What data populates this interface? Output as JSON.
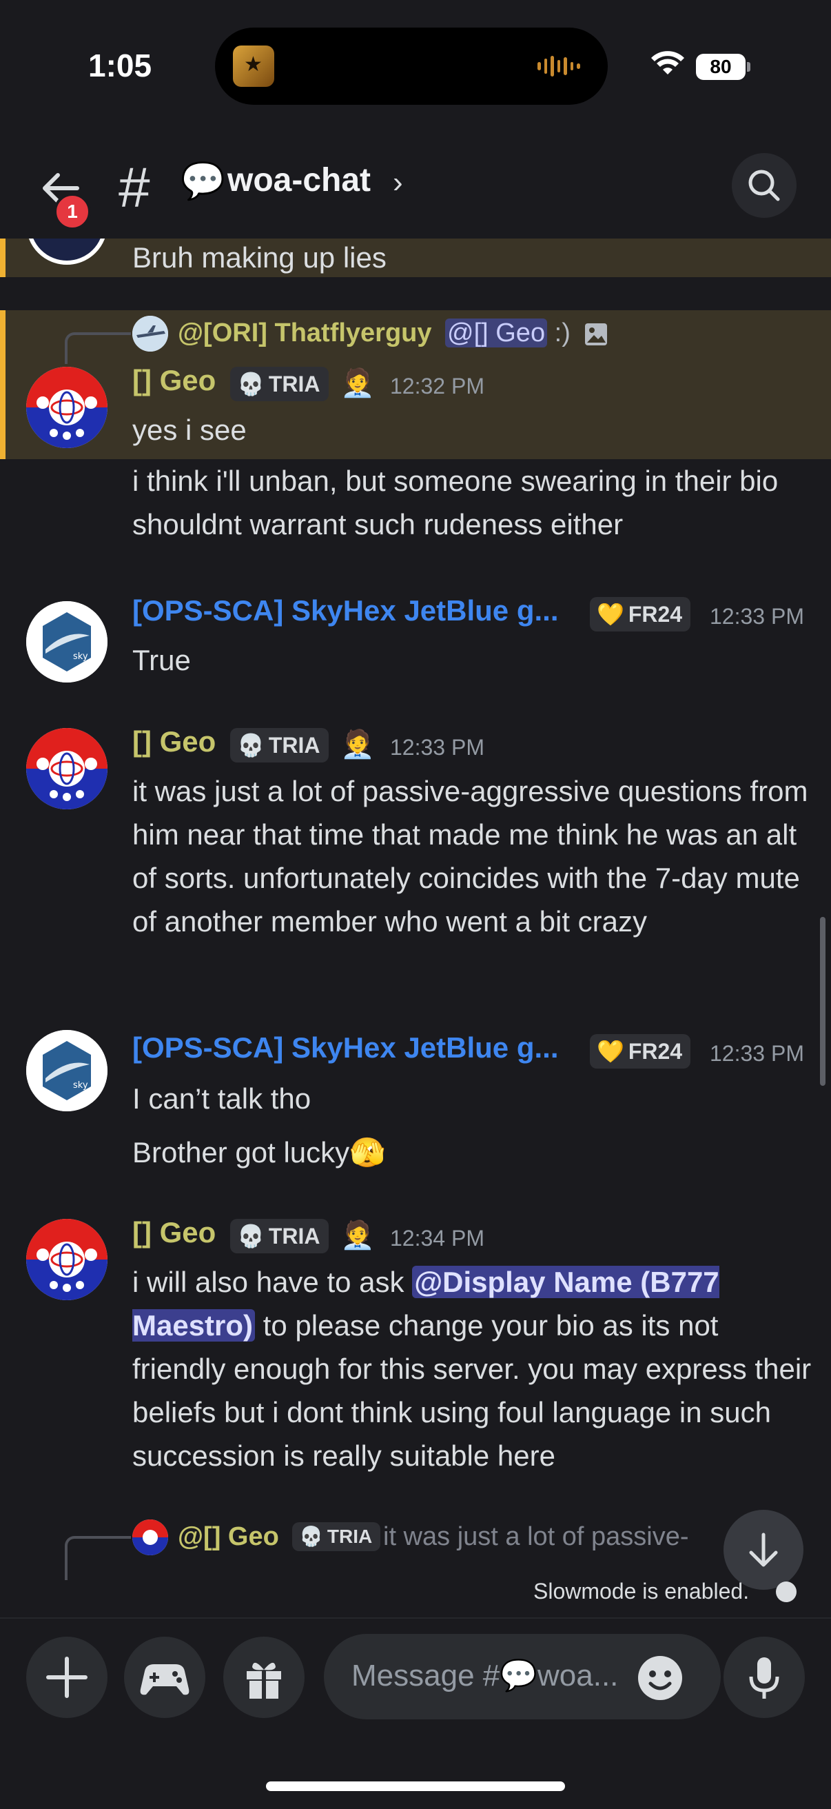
{
  "status_bar": {
    "time": "1:05",
    "battery": "80"
  },
  "header": {
    "back_badge": "1",
    "hash": "#",
    "channel_emoji": "💬",
    "channel_name": "woa-chat",
    "chevron": "›"
  },
  "messages": {
    "partial_top": {
      "text": "Bruh making up lies"
    },
    "m1": {
      "reply_name": "@[ORI] Thatflyerguy",
      "reply_mention": "@[] Geo",
      "reply_text": ":)",
      "author": "[] Geo",
      "tag": "TRIA",
      "time": "12:32 PM",
      "lines": [
        "yes i see",
        "i think i'll unban, but someone swearing in their bio shouldnt warrant such rudeness either"
      ]
    },
    "m2": {
      "author": "[OPS-SCA] SkyHex JetBlue g...",
      "tag": "FR24",
      "time": "12:33 PM",
      "text": "True"
    },
    "m3": {
      "author": "[] Geo",
      "tag": "TRIA",
      "time": "12:33 PM",
      "text": "it was just a lot of passive-aggressive questions from him near that time that made me think he was an alt of sorts. unfortunately coincides with the 7-day mute of another member who went a bit crazy"
    },
    "m4": {
      "author": "[OPS-SCA] SkyHex JetBlue g...",
      "tag": "FR24",
      "time": "12:33 PM",
      "text1": "I can’t talk tho",
      "text2": "Brother got lucky"
    },
    "m5": {
      "author": "[] Geo",
      "tag": "TRIA",
      "time": "12:34 PM",
      "text_before": "i will also have to ask ",
      "mention": "@Display Name (B777 Maestro)",
      "text_after": " to please change your bio as its not friendly enough for this server. you may express their beliefs but i dont think using foul language in such succession is really suitable here"
    },
    "m6": {
      "reply_name": "@[] Geo",
      "reply_tag": "TRIA",
      "reply_text": "it was just a lot of passive-"
    }
  },
  "slowmode": "Slowmode is enabled.",
  "composer": {
    "placeholder": "Message #💬woa..."
  },
  "colors": {
    "geo_name": "#c6c56b",
    "sky_name": "#3e86f0",
    "highlight": "#3a3426",
    "accent_bar": "#f0b232"
  }
}
